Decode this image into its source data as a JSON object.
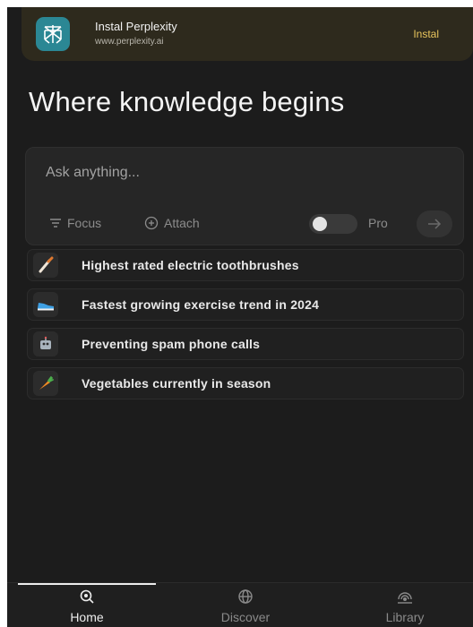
{
  "banner": {
    "title": "Instal Perplexity",
    "url": "www.perplexity.ai",
    "install_label": "Instal",
    "logo_color": "#2b8794",
    "install_color": "#e9c55d"
  },
  "headline": "Where knowledge begins",
  "search": {
    "placeholder": "Ask anything...",
    "focus_label": "Focus",
    "attach_label": "Attach",
    "pro_label": "Pro",
    "pro_enabled": false
  },
  "suggestions": [
    {
      "icon": "toothbrush-icon",
      "text": "Highest rated electric toothbrushes"
    },
    {
      "icon": "sneaker-icon",
      "text": "Fastest growing exercise trend in 2024"
    },
    {
      "icon": "robot-icon",
      "text": "Preventing spam phone calls"
    },
    {
      "icon": "carrot-icon",
      "text": "Vegetables currently in season"
    }
  ],
  "nav": {
    "items": [
      {
        "icon": "home-search-icon",
        "label": "Home",
        "active": true
      },
      {
        "icon": "globe-icon",
        "label": "Discover",
        "active": false
      },
      {
        "icon": "library-icon",
        "label": "Library",
        "active": false
      }
    ]
  },
  "colors": {
    "background": "#1c1c1c",
    "banner_bg": "#2e2a1d",
    "text_primary": "#f4f4f4",
    "text_muted": "#8c8c8c"
  }
}
